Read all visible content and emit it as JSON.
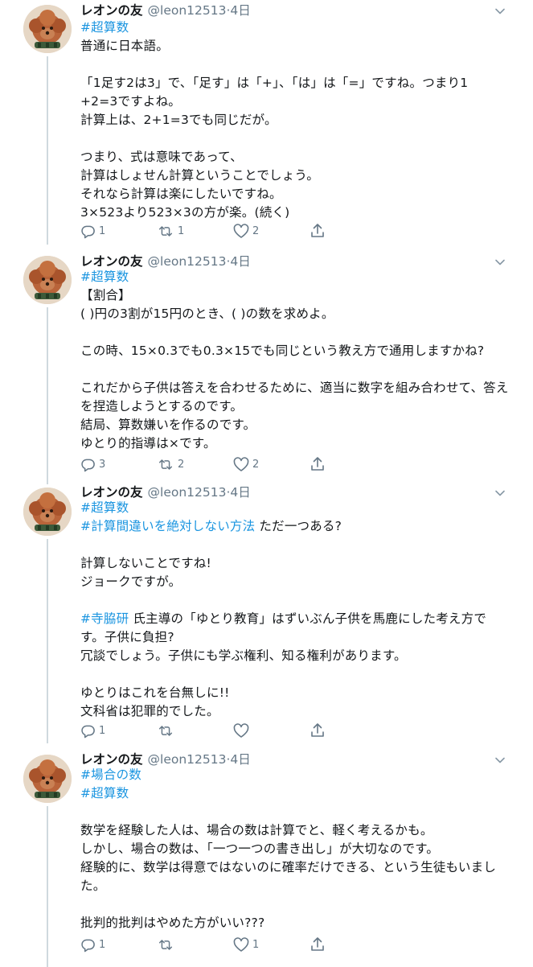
{
  "tweets": [
    {
      "name": "レオンの友",
      "handle": "@leon12513",
      "time": "4日",
      "lines": [
        [
          "#超算数"
        ],
        [
          "普通に日本語。"
        ],
        [],
        [
          "「1足す2は3」で、「足す」は「+」、「は」は「=」ですね。つまり1"
        ],
        [
          "+2=3ですよね。"
        ],
        [
          "計算上は、2+1=3でも同じだが。"
        ],
        [],
        [
          "つまり、式は意味であって、"
        ],
        [
          "計算はしょせん計算ということでしょう。"
        ],
        [
          "それなら計算は楽にしたいですね。"
        ],
        [
          "3×523より523×3の方が楽。(続く)"
        ]
      ],
      "reply_count": "1",
      "retweet_count": "1",
      "like_count": "2"
    },
    {
      "name": "レオンの友",
      "handle": "@leon12513",
      "time": "4日",
      "lines": [
        [
          "#超算数"
        ],
        [
          "【割合】"
        ],
        [
          "(  )円の3割が15円のとき、(  )の数を求めよ。"
        ],
        [],
        [
          "この時、15×0.3でも0.3×15でも同じという教え方で通用しますかね?"
        ],
        [],
        [
          "これだから子供は答えを合わせるために、適当に数字を組み合わせて、答え"
        ],
        [
          "を捏造しようとするのです。"
        ],
        [
          "結局、算数嫌いを作るのです。"
        ],
        [
          "ゆとり的指導は×です。"
        ]
      ],
      "reply_count": "3",
      "retweet_count": "2",
      "like_count": "2"
    },
    {
      "name": "レオンの友",
      "handle": "@leon12513",
      "time": "4日",
      "lines": [
        [
          "#超算数"
        ],
        [
          "#計算間違いを絶対しない方法",
          " ただ一つある?"
        ],
        [],
        [
          "計算しないことですね!"
        ],
        [
          "ジョークですが。"
        ],
        [],
        [
          "#寺脇研",
          " 氏主導の「ゆとり教育」はずいぶん子供を馬鹿にした考え方で"
        ],
        [
          "す。子供に負担?"
        ],
        [
          "冗談でしょう。子供にも学ぶ権利、知る権利があります。"
        ],
        [],
        [
          "ゆとりはこれを台無しに!!"
        ],
        [
          "文科省は犯罪的でした。"
        ]
      ],
      "reply_count": "1",
      "retweet_count": "",
      "like_count": ""
    },
    {
      "name": "レオンの友",
      "handle": "@leon12513",
      "time": "4日",
      "lines": [
        [
          "#場合の数"
        ],
        [
          "#超算数"
        ],
        [],
        [
          "数学を経験した人は、場合の数は計算でと、軽く考えるかも。"
        ],
        [
          "しかし、場合の数は、「一つ一つの書き出し」が大切なのです。"
        ],
        [
          "経験的に、数学は得意ではないのに確率だけできる、という生徒もいまし"
        ],
        [
          "た。"
        ],
        [],
        [
          "批判的批判はやめた方がいい???"
        ]
      ],
      "reply_count": "1",
      "retweet_count": "",
      "like_count": "1"
    }
  ],
  "colors": {
    "hashtag": "#1b95e0",
    "meta_text": "#657786",
    "thread_line": "#cfd9de"
  },
  "icons": [
    "avatar",
    "chevron-down-icon",
    "reply-icon",
    "retweet-icon",
    "like-icon",
    "share-icon"
  ]
}
